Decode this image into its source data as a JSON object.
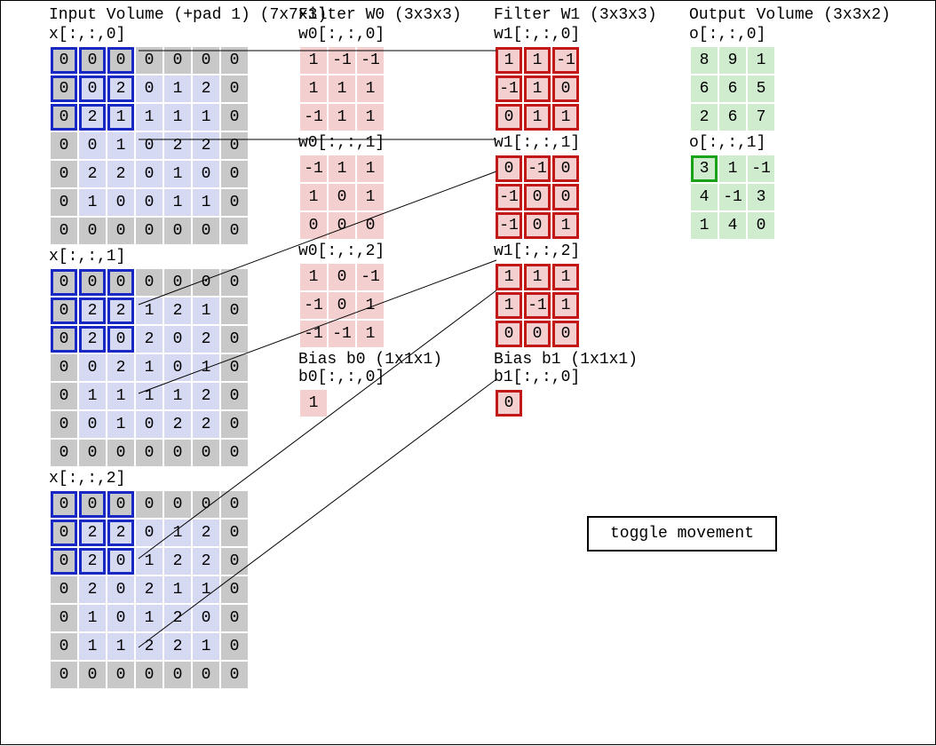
{
  "headings": {
    "input": "Input Volume (+pad 1) (7x7x3)",
    "w0": "Filter W0 (3x3x3)",
    "w1": "Filter W1 (3x3x3)",
    "output": "Output Volume (3x3x2)",
    "bias0": "Bias b0 (1x1x1)",
    "bias1": "Bias b1 (1x1x1)",
    "toggle": "toggle movement"
  },
  "labels": {
    "x": "x[:,:,",
    "w0": "w0[:,:,",
    "w1": "w1[:,:,",
    "b0": "b0[:,:,",
    "b1": "b1[:,:,",
    "o": "o[:,:,",
    "close": "]"
  },
  "chart_data": {
    "type": "table",
    "input": {
      "shape": "7x7x3",
      "slices": [
        [
          [
            0,
            0,
            0,
            0,
            0,
            0,
            0
          ],
          [
            0,
            0,
            2,
            0,
            1,
            2,
            0
          ],
          [
            0,
            2,
            1,
            1,
            1,
            1,
            0
          ],
          [
            0,
            0,
            1,
            0,
            2,
            2,
            0
          ],
          [
            0,
            2,
            2,
            0,
            1,
            0,
            0
          ],
          [
            0,
            1,
            0,
            0,
            1,
            1,
            0
          ],
          [
            0,
            0,
            0,
            0,
            0,
            0,
            0
          ]
        ],
        [
          [
            0,
            0,
            0,
            0,
            0,
            0,
            0
          ],
          [
            0,
            2,
            2,
            1,
            2,
            1,
            0
          ],
          [
            0,
            2,
            0,
            2,
            0,
            2,
            0
          ],
          [
            0,
            0,
            2,
            1,
            0,
            1,
            0
          ],
          [
            0,
            1,
            1,
            1,
            1,
            2,
            0
          ],
          [
            0,
            0,
            1,
            0,
            2,
            2,
            0
          ],
          [
            0,
            0,
            0,
            0,
            0,
            0,
            0
          ]
        ],
        [
          [
            0,
            0,
            0,
            0,
            0,
            0,
            0
          ],
          [
            0,
            2,
            2,
            0,
            1,
            2,
            0
          ],
          [
            0,
            2,
            0,
            1,
            2,
            2,
            0
          ],
          [
            0,
            2,
            0,
            2,
            1,
            1,
            0
          ],
          [
            0,
            1,
            0,
            1,
            2,
            0,
            0
          ],
          [
            0,
            1,
            1,
            2,
            2,
            1,
            0
          ],
          [
            0,
            0,
            0,
            0,
            0,
            0,
            0
          ]
        ]
      ],
      "highlight": {
        "rows": [
          0,
          1,
          2
        ],
        "cols": [
          0,
          1,
          2
        ]
      }
    },
    "w0": {
      "shape": "3x3x3",
      "slices": [
        [
          [
            1,
            -1,
            -1
          ],
          [
            1,
            1,
            1
          ],
          [
            -1,
            1,
            1
          ]
        ],
        [
          [
            -1,
            1,
            1
          ],
          [
            1,
            0,
            1
          ],
          [
            0,
            0,
            0
          ]
        ],
        [
          [
            1,
            0,
            -1
          ],
          [
            -1,
            0,
            1
          ],
          [
            -1,
            -1,
            1
          ]
        ]
      ]
    },
    "w1": {
      "shape": "3x3x3",
      "slices": [
        [
          [
            1,
            1,
            -1
          ],
          [
            -1,
            1,
            0
          ],
          [
            0,
            1,
            1
          ]
        ],
        [
          [
            0,
            -1,
            0
          ],
          [
            -1,
            0,
            0
          ],
          [
            -1,
            0,
            1
          ]
        ],
        [
          [
            1,
            1,
            1
          ],
          [
            1,
            -1,
            1
          ],
          [
            0,
            0,
            0
          ]
        ]
      ],
      "highlight_all": true
    },
    "b0": {
      "shape": "1x1x1",
      "value": 1
    },
    "b1": {
      "shape": "1x1x1",
      "value": 0,
      "highlight": true
    },
    "output": {
      "shape": "3x3x2",
      "slices": [
        [
          [
            8,
            9,
            1
          ],
          [
            6,
            6,
            5
          ],
          [
            2,
            6,
            7
          ]
        ],
        [
          [
            3,
            1,
            -1
          ],
          [
            4,
            -1,
            3
          ],
          [
            1,
            4,
            0
          ]
        ]
      ],
      "highlight": {
        "slice": 1,
        "row": 0,
        "col": 0
      }
    }
  }
}
